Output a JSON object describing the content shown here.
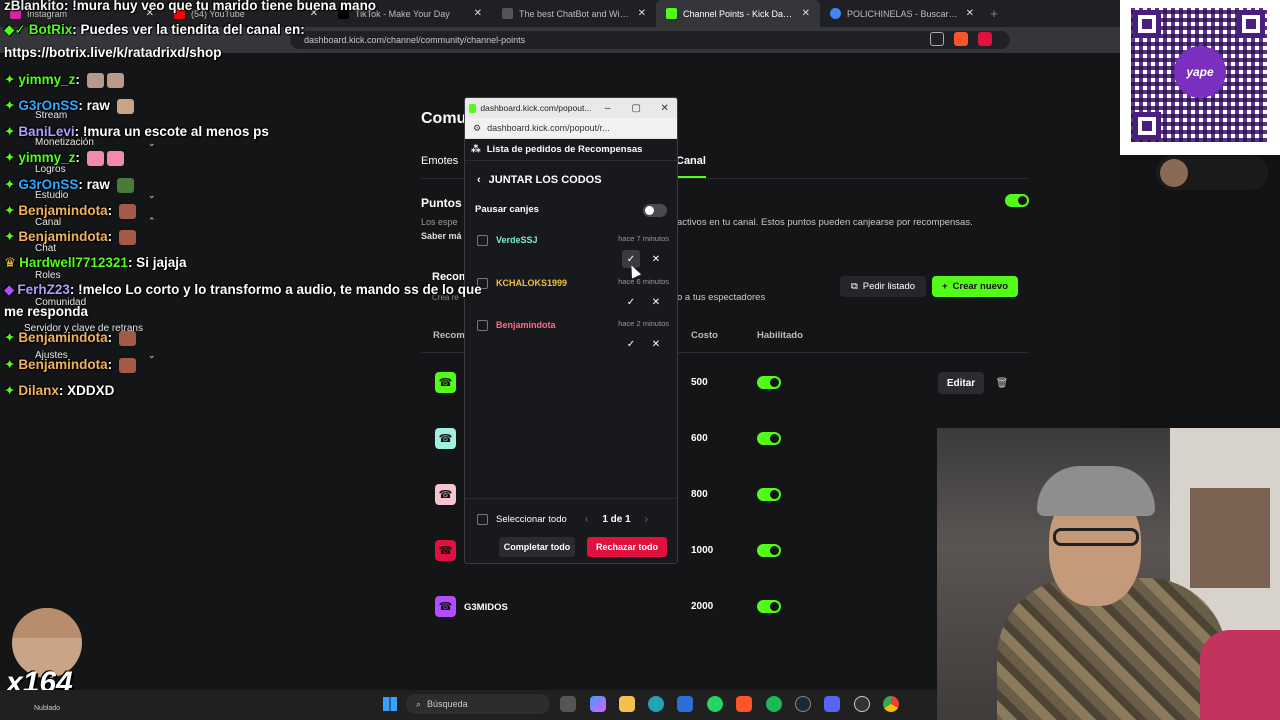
{
  "browser": {
    "tabs": [
      {
        "title": "Instagram",
        "favicon_color": "#d6249f",
        "active": false
      },
      {
        "title": "(54) YouTube",
        "favicon_color": "#ff0000",
        "active": false
      },
      {
        "title": "TikTok - Make Your Day",
        "favicon_color": "#000000",
        "active": false
      },
      {
        "title": "The best ChatBot and Widgets for K...",
        "favicon_color": "#222222",
        "active": false
      },
      {
        "title": "Channel Points - Kick Dashboard",
        "favicon_color": "#53fc18",
        "active": true
      },
      {
        "title": "POLICHINELAS - Buscar con Google",
        "favicon_color": "#4285f4",
        "active": false
      }
    ],
    "tab_close": "✕",
    "new_tab": "+",
    "url": "dashboard.kick.com/channel/community/channel-points"
  },
  "dashboard": {
    "title": "Comu",
    "tabs": [
      "Emotes"
    ],
    "active_tab": "Canal",
    "points_title": "Puntos",
    "points_desc": "Los espe",
    "points_desc_visible": "activos en tu canal. Estos puntos pueden canjearse por recompensas.",
    "learn_more": "Saber má",
    "rewards_title": "Recom",
    "rewards_desc": "Crea re",
    "rewards_desc_visible": "o a tus espectadores",
    "btn_list": "Pedir listado",
    "btn_create": "Crear nuevo",
    "columns": {
      "reward": "Recom",
      "cost": "Costo",
      "enabled": "Habilitado"
    },
    "rewards": [
      {
        "name": "",
        "cost": "500",
        "color": "#53fc18",
        "enabled": true
      },
      {
        "name": "",
        "cost": "600",
        "color": "#9ef0e0",
        "enabled": true
      },
      {
        "name": "",
        "cost": "800",
        "color": "#f6c5cf",
        "enabled": true
      },
      {
        "name": "",
        "cost": "1000",
        "color": "#e0103f",
        "enabled": true
      },
      {
        "name": "G3MIDOS",
        "cost": "2000",
        "color": "#b44cff",
        "enabled": true
      }
    ],
    "btn_edit": "Editar"
  },
  "popup": {
    "window_title": "dashboard.kick.com/popout...",
    "url": "dashboard.kick.com/popout/r...",
    "header": "Lista de pedidos de Recompensas",
    "reward_name": "JUNTAR LOS CODOS",
    "pause_label": "Pausar canjes",
    "pause_enabled": false,
    "requests": [
      {
        "user": "VerdeSSJ",
        "time": "hace 7 minutos",
        "color": "#7ff0c8"
      },
      {
        "user": "KCHALOKS1999",
        "time": "hace 6 minutos",
        "color": "#f0c23a"
      },
      {
        "user": "Benjamindota",
        "time": "hace 2 minutos",
        "color": "#ff6b8b"
      }
    ],
    "select_all": "Seleccionar todo",
    "pager": "1 de 1",
    "btn_complete_all": "Completar todo",
    "btn_reject_all": "Rechazar todo"
  },
  "chat": {
    "messages": [
      {
        "user": "zBlankito",
        "text": ": !mura huy veo que tu marido tiene buena mano",
        "color": "#f0f0f0"
      },
      {
        "user": "BotRix",
        "text": ": Puedes ver la tiendita del canal en:",
        "color": "#53fc18"
      },
      {
        "user": "yimmy_z",
        "text": ":",
        "color": "#53fc18"
      },
      {
        "user": "G3rOnSS",
        "text": ": raw",
        "color": "#2fa8ff"
      },
      {
        "user": "BaniLevi",
        "text": ": !mura un escote al menos ps",
        "color": "#b49cff"
      },
      {
        "user": "yimmy_z",
        "text": ":",
        "color": "#53fc18"
      },
      {
        "user": "G3rOnSS",
        "text": ": raw",
        "color": "#2fa8ff"
      },
      {
        "user": "Benjamindota",
        "text": ":",
        "color": "#f2b25b"
      },
      {
        "user": "Benjamindota",
        "text": ":",
        "color": "#f2b25b"
      },
      {
        "user": "Hardwell7712321",
        "text": ": Si jajaja",
        "color": "#53fc18"
      },
      {
        "user": "FerhZ23",
        "text": ": !melco Lo corto y lo transformo a audio, te mando ss de lo que",
        "color": "#b49cff"
      },
      {
        "user": "Benjamindota",
        "text": ":",
        "color": "#f2b25b"
      },
      {
        "user": "Benjamindota",
        "text": ":",
        "color": "#f2b25b"
      },
      {
        "user": "Dilanx",
        "text": ": XDDXD",
        "color": "#f2b25b"
      }
    ],
    "continuations": [
      "https://botrix.live/k/ratadrixd/shop",
      "me responda"
    ]
  },
  "sidebar": {
    "items": [
      "Stream",
      "Monetización",
      "Logros",
      "Estudio",
      "Canal",
      "Chat",
      "Roles",
      "Comunidad",
      "Servidor y clave de retrans",
      "Ajustes"
    ]
  },
  "overlay": {
    "qr_brand": "yape",
    "sub_count": "x164"
  },
  "taskbar": {
    "search_placeholder": "Búsqueda",
    "weather": "Nublado"
  }
}
